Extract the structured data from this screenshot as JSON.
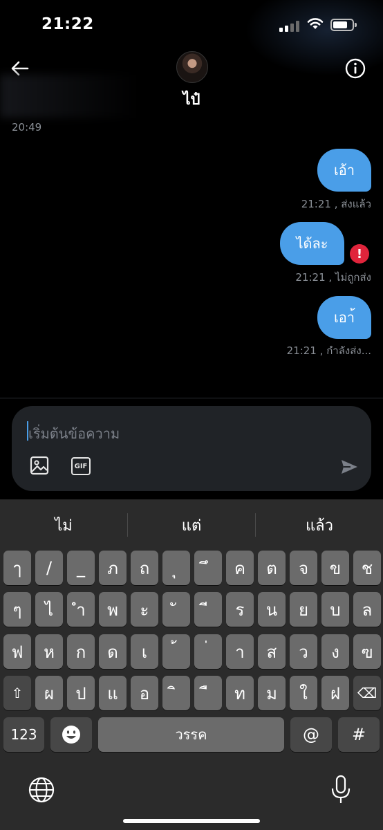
{
  "status_bar": {
    "time": "21:22",
    "battery_level": 0.78
  },
  "header": {
    "contact_name": "ไป๋",
    "previous_time": "20:49"
  },
  "messages": [
    {
      "text": "เอ้า",
      "meta": "21:21 , ส่งแล้ว"
    },
    {
      "text": "ได้ละ",
      "meta": "21:21 , ไม่ถูกส่ง",
      "error": "!"
    },
    {
      "text": "เอา้",
      "meta": "21:21 , กำลังส่ง..."
    }
  ],
  "composer": {
    "placeholder": "เริ่มต้นข้อความ",
    "gif_label": "GIF"
  },
  "keyboard": {
    "suggestions": [
      "ไม่",
      "แต่",
      "แล้ว"
    ],
    "row1": [
      "ๅ",
      "/",
      "_",
      "ภ",
      "ถ",
      "ุ",
      "ึ",
      "ค",
      "ต",
      "จ",
      "ข",
      "ช"
    ],
    "row2": [
      "ๆ",
      "ไ",
      "ำ",
      "พ",
      "ะ",
      "ั",
      "ี",
      "ร",
      "น",
      "ย",
      "บ",
      "ล"
    ],
    "row3": [
      "ฟ",
      "ห",
      "ก",
      "ด",
      "เ",
      "้",
      "่",
      "า",
      "ส",
      "ว",
      "ง",
      "ฃ"
    ],
    "row4": [
      "ผ",
      "ป",
      "แ",
      "อ",
      "ิ",
      "ื",
      "ท",
      "ม",
      "ใ",
      "ฝ"
    ],
    "shift_symbol": "⇧",
    "delete_symbol": "⌫",
    "numbers_label": "123",
    "emoji_symbol": "☺",
    "space_label": "วรรค",
    "at_label": "@",
    "hash_label": "#"
  },
  "colors": {
    "bubble": "#4a9ee8",
    "error": "#e0243b",
    "keyboard_bg": "#2b2b2b",
    "key": "#6b6b6b"
  }
}
